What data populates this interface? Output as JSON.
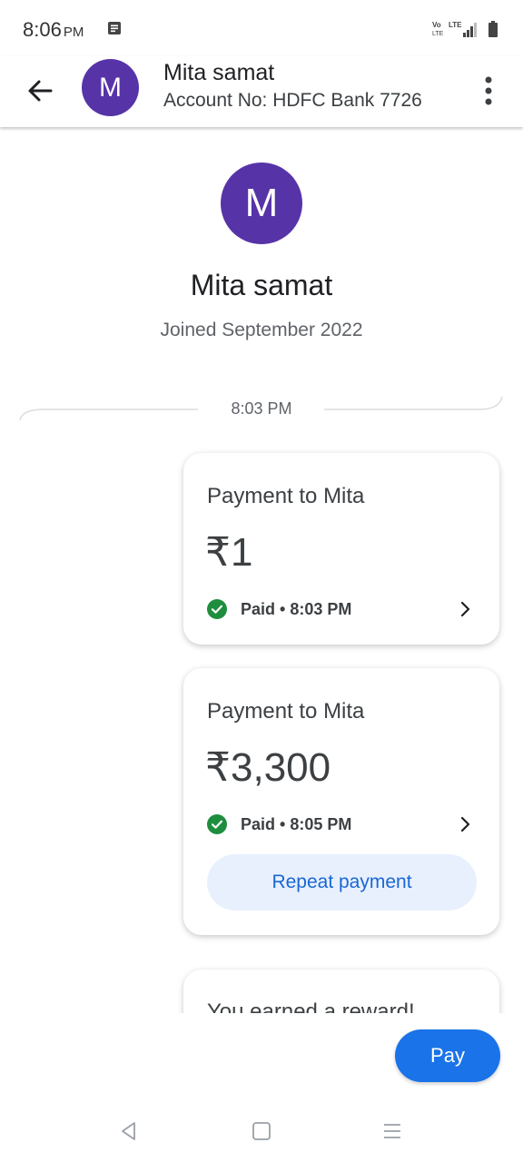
{
  "status_bar": {
    "time": "8:06",
    "ampm": "PM",
    "icons": [
      "notification-icon",
      "volte-icon",
      "lte-icon",
      "signal-icon",
      "battery-icon"
    ]
  },
  "header": {
    "avatar_letter": "M",
    "name": "Mita samat",
    "subtitle": "Account No: HDFC Bank 7726"
  },
  "profile": {
    "avatar_letter": "M",
    "name": "Mita samat",
    "joined": "Joined September 2022"
  },
  "thread": {
    "divider_time": "8:03 PM",
    "payments": [
      {
        "title": "Payment to Mita",
        "amount": "₹1",
        "status": "Paid • 8:03 PM"
      },
      {
        "title": "Payment to Mita",
        "amount": "₹3,300",
        "status": "Paid • 8:05 PM",
        "action_label": "Repeat payment"
      }
    ],
    "reward_title": "You earned a reward!"
  },
  "actions": {
    "pay_label": "Pay"
  },
  "colors": {
    "avatar": "#5733a8",
    "primary": "#1a73e8",
    "success": "#1e8e3e",
    "repeat_bg": "#e8f0fe"
  }
}
